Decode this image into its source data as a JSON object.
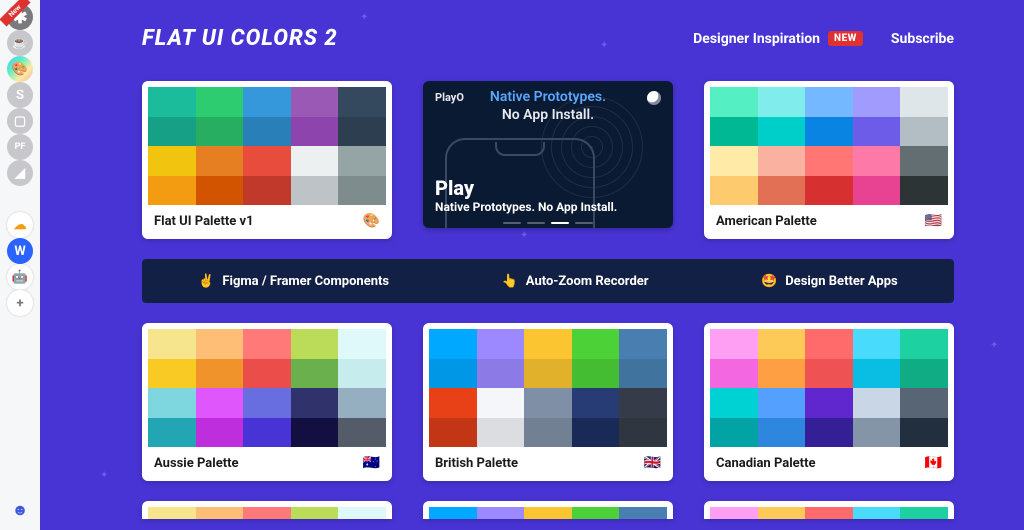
{
  "header": {
    "title": "FLAT UI COLORS 2",
    "nav": {
      "inspiration": "Designer Inspiration",
      "new_badge": "NEW",
      "subscribe": "Subscribe"
    }
  },
  "sidebar": {
    "items": [
      {
        "name": "asterisk",
        "glyph": "✱",
        "has_new": true
      },
      {
        "name": "cup",
        "glyph": "☕"
      },
      {
        "name": "palette",
        "glyph": "🎨"
      },
      {
        "name": "s",
        "glyph": "S"
      },
      {
        "name": "chat",
        "glyph": "▢"
      },
      {
        "name": "pf",
        "glyph": "PF"
      },
      {
        "name": "chart",
        "glyph": "◢"
      }
    ],
    "lower": [
      {
        "name": "cloud",
        "glyph": "☁",
        "cls": "white",
        "color": "#f39c12"
      },
      {
        "name": "w",
        "glyph": "W",
        "cls": "blue"
      },
      {
        "name": "robot",
        "glyph": "🤖",
        "cls": "white",
        "color": "#111"
      },
      {
        "name": "plus",
        "glyph": "+",
        "cls": "white",
        "color": "#777"
      }
    ],
    "bottom_glyph": "☻"
  },
  "promo": {
    "logo": "PlayO",
    "line1": "Native Prototypes.",
    "line2": "No App Install.",
    "caption_big": "Play",
    "caption_small": "Native Prototypes. No App Install.",
    "active_dot_index": 2,
    "dot_count": 4
  },
  "promo_bar": [
    {
      "emoji": "✌️",
      "label": "Figma / Framer Components"
    },
    {
      "emoji": "👆",
      "label": "Auto-Zoom Recorder"
    },
    {
      "emoji": "🤩",
      "label": "Design Better Apps"
    }
  ],
  "palettes": [
    {
      "id": "flat-v1",
      "title": "Flat UI Palette v1",
      "flag": "🎨",
      "colors": [
        "#1abc9c",
        "#2ecc71",
        "#3498db",
        "#9b59b6",
        "#34495e",
        "#16a085",
        "#27ae60",
        "#2980b9",
        "#8e44ad",
        "#2c3e50",
        "#f1c40f",
        "#e67e22",
        "#e74c3c",
        "#ecf0f1",
        "#95a5a6",
        "#f39c12",
        "#d35400",
        "#c0392b",
        "#bdc3c7",
        "#7f8c8d"
      ]
    },
    {
      "id": "american",
      "title": "American Palette",
      "flag": "🇺🇸",
      "colors": [
        "#55efc4",
        "#81ecec",
        "#74b9ff",
        "#a29bfe",
        "#dfe6e9",
        "#00b894",
        "#00cec9",
        "#0984e3",
        "#6c5ce7",
        "#b2bec3",
        "#ffeaa7",
        "#fab1a0",
        "#ff7675",
        "#fd79a8",
        "#636e72",
        "#fdcb6e",
        "#e17055",
        "#d63031",
        "#e84393",
        "#2d3436"
      ]
    },
    {
      "id": "aussie",
      "title": "Aussie Palette",
      "flag": "🇦🇺",
      "colors": [
        "#f6e58d",
        "#ffbe76",
        "#ff7979",
        "#badc58",
        "#dff9fb",
        "#f9ca24",
        "#f0932b",
        "#eb4d4b",
        "#6ab04c",
        "#c7ecee",
        "#7ed6df",
        "#e056fd",
        "#686de0",
        "#30336b",
        "#95afc0",
        "#22a6b3",
        "#be2edd",
        "#4834d4",
        "#130f40",
        "#535c68"
      ]
    },
    {
      "id": "british",
      "title": "British Palette",
      "flag": "🇬🇧",
      "colors": [
        "#00a8ff",
        "#9c88ff",
        "#fbc531",
        "#4cd137",
        "#487eb0",
        "#0097e6",
        "#8c7ae6",
        "#e1b12c",
        "#44bd32",
        "#40739e",
        "#e84118",
        "#f5f6fa",
        "#7f8fa6",
        "#273c75",
        "#353b48",
        "#c23616",
        "#dcdde1",
        "#718093",
        "#192a56",
        "#2f3640"
      ]
    },
    {
      "id": "canadian",
      "title": "Canadian Palette",
      "flag": "🇨🇦",
      "colors": [
        "#ff9ff3",
        "#feca57",
        "#ff6b6b",
        "#48dbfb",
        "#1dd1a1",
        "#f368e0",
        "#ff9f43",
        "#ee5253",
        "#0abde3",
        "#10ac84",
        "#00d2d3",
        "#54a0ff",
        "#5f27cd",
        "#c8d6e5",
        "#576574",
        "#01a3a4",
        "#2e86de",
        "#341f97",
        "#8395a7",
        "#222f3e"
      ]
    }
  ],
  "peek_colors": [
    [
      "#f6e58d",
      "#ffbe76",
      "#ff7979",
      "#badc58",
      "#dff9fb"
    ],
    [
      "#00a8ff",
      "#9c88ff",
      "#fbc531",
      "#4cd137",
      "#487eb0"
    ],
    [
      "#ff9ff3",
      "#feca57",
      "#ff6b6b",
      "#48dbfb",
      "#1dd1a1"
    ]
  ]
}
